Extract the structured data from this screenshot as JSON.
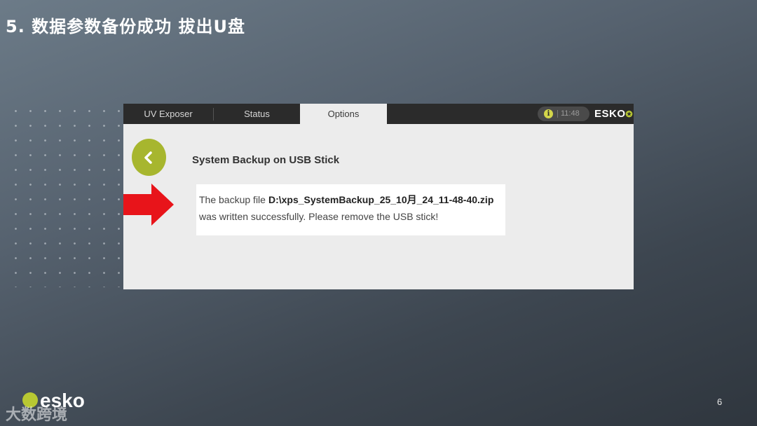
{
  "slide": {
    "title": "5. 数据参数备份成功 拔出U盘",
    "page_number": "6"
  },
  "app": {
    "tabs": [
      {
        "label": "UV Exposer",
        "active": false
      },
      {
        "label": "Status",
        "active": false
      },
      {
        "label": "Options",
        "active": true
      }
    ],
    "status_bar": {
      "info_icon": "i",
      "time": "11:48",
      "brand": "ESKO"
    },
    "page_heading": "System Backup on USB Stick",
    "message": {
      "prefix": "The backup file",
      "filename": "D:\\xps_SystemBackup_25_10月_24_11-48-40.zip",
      "line2": "was written successfully. Please remove the USB stick!"
    }
  },
  "footer": {
    "logo_text": "esko",
    "watermark": "大数跨境"
  },
  "colors": {
    "accent_green": "#a7b62e",
    "arrow_red": "#e8141a",
    "topbar": "#2b2b2b",
    "content_bg": "#ececec"
  }
}
